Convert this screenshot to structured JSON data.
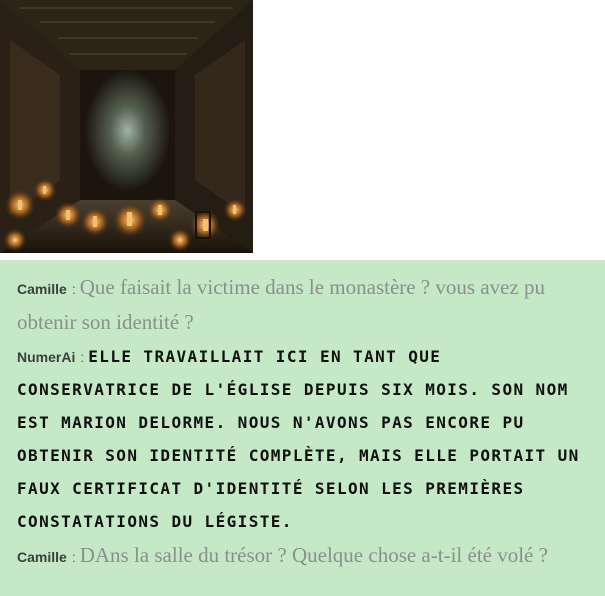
{
  "scene_image": {
    "description_icon": "monastery-corridor-image"
  },
  "chat": {
    "messages": [
      {
        "speaker": "Camille",
        "separator": ":",
        "text": "Que faisait la victime dans le monastère ? vous avez pu obtenir son identité ?",
        "kind": "user"
      },
      {
        "speaker": "NumerAi",
        "separator": ":",
        "text": "Elle travaillait ici en tant que conservatrice de l'église depuis six mois. Son nom est Marion Delorme. Nous n'avons pas encore pu obtenir son identité complète, mais elle portait un faux certificat d'identité selon les premières constatations du légiste.",
        "kind": "ai"
      },
      {
        "speaker": "Camille",
        "separator": ":",
        "text": "DAns la salle du trésor ? Quelque chose a-t-il été volé ?",
        "kind": "user"
      }
    ]
  },
  "colors": {
    "chat_background": "#c5e9c7",
    "user_text": "#8a8f8a",
    "ai_text": "#111111"
  }
}
